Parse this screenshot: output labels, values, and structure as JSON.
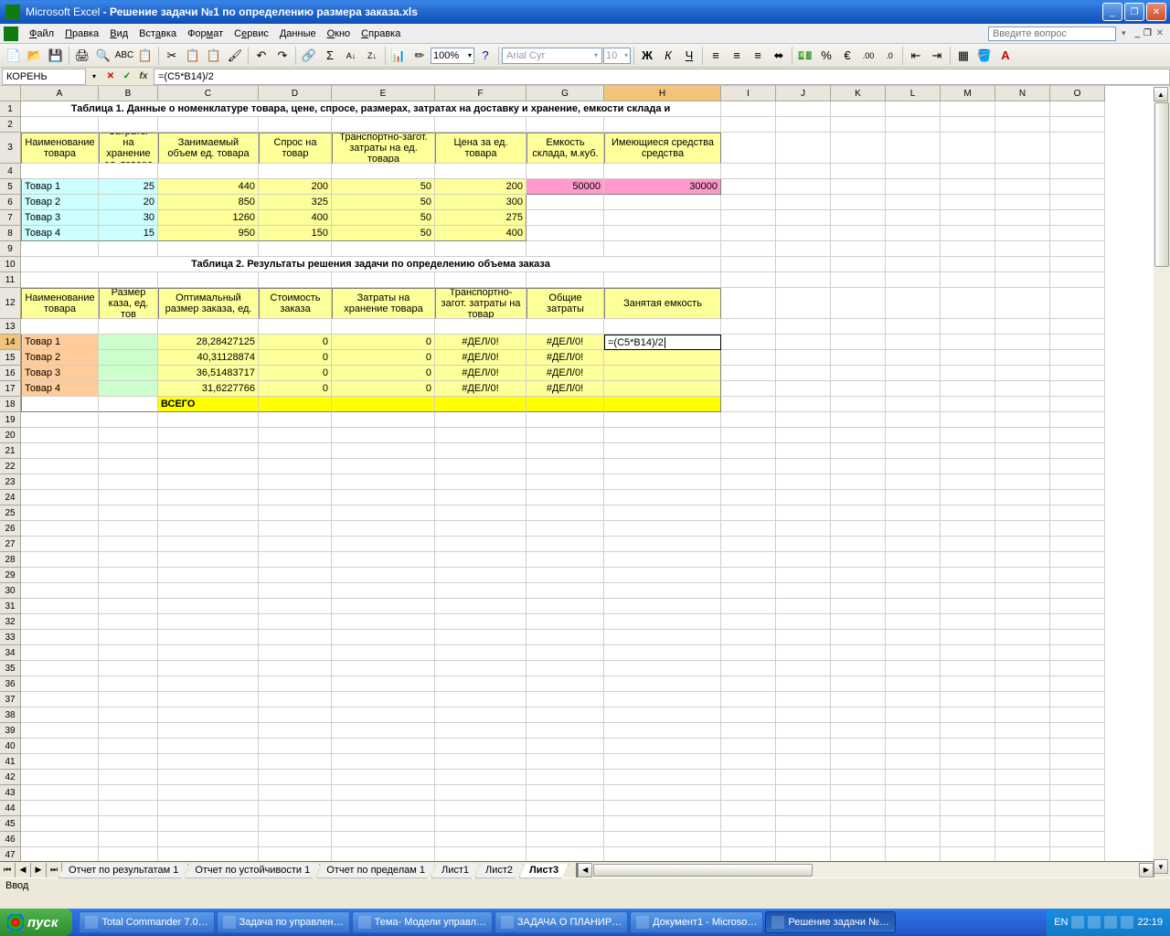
{
  "title": {
    "app": "Microsoft Excel",
    "file": "Решение задачи №1 по определению размера заказа.xls"
  },
  "menu": {
    "file": "Файл",
    "edit": "Правка",
    "view": "Вид",
    "insert": "Вставка",
    "format": "Формат",
    "tools": "Сервис",
    "data": "Данные",
    "window": "Окно",
    "help": "Справка",
    "search_placeholder": "Введите вопрос"
  },
  "toolbar": {
    "zoom": "100%",
    "font": "Arial Cyr",
    "size": "10"
  },
  "formula": {
    "name": "КОРЕНЬ",
    "value": "=(C5*B14)/2"
  },
  "colWidths": {
    "A": 85,
    "B": 65,
    "C": 110,
    "D": 80,
    "E": 113,
    "F": 100,
    "G": 85,
    "H": 128,
    "I": 60,
    "J": 60,
    "K": 60,
    "L": 60,
    "M": 60,
    "N": 60,
    "O": 60
  },
  "cols": [
    "A",
    "B",
    "C",
    "D",
    "E",
    "F",
    "G",
    "H",
    "I",
    "J",
    "K",
    "L",
    "M",
    "N",
    "O"
  ],
  "table1": {
    "title": "Таблица 1. Данные о номенклатуре товара, цене, спросе, размерах, затратах на доставку и хранение, емкости склада и",
    "headers": [
      "Наименование товара",
      "Затраты на хранение ед. товара",
      "Занимаемый объем ед. товара",
      "Спрос на товар",
      "Транспортно-загот. затраты на ед. товара",
      "Цена за ед. товара",
      "Емкость склада, м.куб.",
      "Имеющиеся средства средства"
    ],
    "rows": [
      [
        "Товар 1",
        "25",
        "440",
        "200",
        "50",
        "200",
        "50000",
        "30000"
      ],
      [
        "Товар 2",
        "20",
        "850",
        "325",
        "50",
        "300",
        "",
        ""
      ],
      [
        "Товар 3",
        "30",
        "1260",
        "400",
        "50",
        "275",
        "",
        ""
      ],
      [
        "Товар 4",
        "15",
        "950",
        "150",
        "50",
        "400",
        "",
        ""
      ]
    ]
  },
  "table2": {
    "title": "Таблица 2. Результаты решения задачи по определению объема заказа",
    "headers": [
      "Наименование товара",
      "Размер каза, ед. тов",
      "Оптимальный размер заказа, ед.",
      "Стоимость заказа",
      "Затраты на хранение товара",
      "Транспортно-загот. затраты на товар",
      "Общие затраты",
      "Занятая емкость"
    ],
    "rows": [
      [
        "Товар 1",
        "",
        "28,28427125",
        "0",
        "0",
        "#ДЕЛ/0!",
        "#ДЕЛ/0!",
        "=(C5*B14)/2"
      ],
      [
        "Товар 2",
        "",
        "40,31128874",
        "0",
        "0",
        "#ДЕЛ/0!",
        "#ДЕЛ/0!",
        ""
      ],
      [
        "Товар 3",
        "",
        "36,51483717",
        "0",
        "0",
        "#ДЕЛ/0!",
        "#ДЕЛ/0!",
        ""
      ],
      [
        "Товар 4",
        "",
        "31,6227766",
        "0",
        "0",
        "#ДЕЛ/0!",
        "#ДЕЛ/0!",
        ""
      ]
    ],
    "total": "ВСЕГО"
  },
  "tabs": [
    "Отчет по результатам 1",
    "Отчет по устойчивости 1",
    "Отчет по пределам 1",
    "Лист1",
    "Лист2",
    "Лист3"
  ],
  "activeTab": "Лист3",
  "status": "Ввод",
  "taskbar": {
    "start": "пуск",
    "items": [
      "Total Commander 7.0…",
      "Задача по управлен…",
      "Тема- Модели управл…",
      "ЗАДАЧА О ПЛАНИР…",
      "Документ1 - Microso…",
      "Решение задачи №…"
    ],
    "lang": "EN",
    "time": "22:19"
  }
}
